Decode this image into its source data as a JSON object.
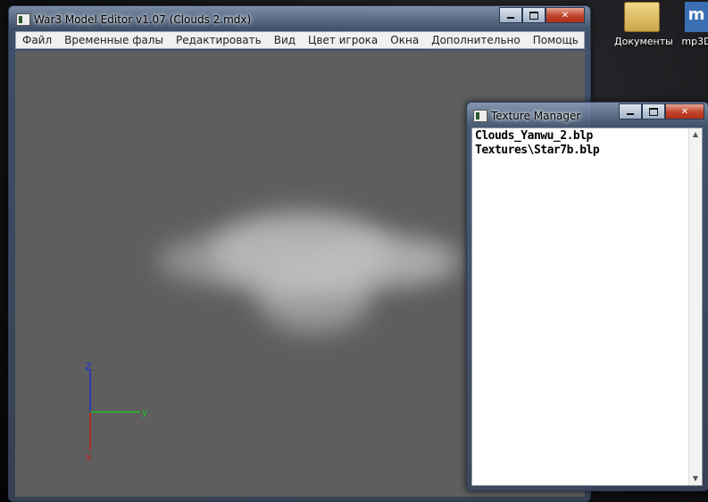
{
  "desktop": {
    "icons": [
      {
        "label": "Документы",
        "icon": "folder-icon"
      },
      {
        "label": "mp3D",
        "icon": "mp3d-icon"
      }
    ]
  },
  "main_window": {
    "title": "War3 Model Editor v1.07 (Clouds 2.mdx)",
    "menu": [
      "Файл",
      "Временные фалы",
      "Редактировать",
      "Вид",
      "Цвет игрока",
      "Окна",
      "Дополнительно",
      "Помощь"
    ],
    "viewport": {
      "background": "#5e5e5e",
      "axes": {
        "z_label": "Z",
        "y_label": "y",
        "x_label": "x",
        "z_color": "#1a2fcf",
        "y_color": "#1fc21f",
        "x_color": "#c41e1e"
      }
    }
  },
  "texture_manager": {
    "title": "Texture Manager",
    "items": [
      "Clouds_Yanwu_2.blp",
      "Textures\\Star7b.blp"
    ]
  }
}
